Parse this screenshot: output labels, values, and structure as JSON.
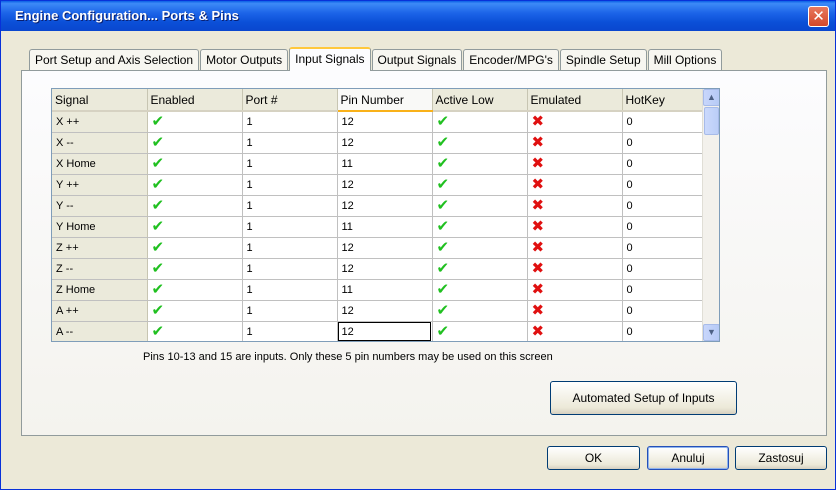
{
  "window": {
    "title": "Engine Configuration... Ports & Pins",
    "close_glyph": "✕"
  },
  "tabs": [
    {
      "label": "Port Setup and Axis Selection"
    },
    {
      "label": "Motor Outputs"
    },
    {
      "label": "Input Signals",
      "active": true
    },
    {
      "label": "Output Signals"
    },
    {
      "label": "Encoder/MPG's"
    },
    {
      "label": "Spindle Setup"
    },
    {
      "label": "Mill Options"
    }
  ],
  "grid": {
    "columns": [
      "Signal",
      "Enabled",
      "Port #",
      "Pin Number",
      "Active Low",
      "Emulated",
      "HotKey"
    ],
    "selected_column": "Pin Number",
    "rows": [
      {
        "signal": "X ++",
        "enabled": true,
        "port": "1",
        "pin": "12",
        "active_low": true,
        "emulated": false,
        "hotkey": "0"
      },
      {
        "signal": "X --",
        "enabled": true,
        "port": "1",
        "pin": "12",
        "active_low": true,
        "emulated": false,
        "hotkey": "0"
      },
      {
        "signal": "X Home",
        "enabled": true,
        "port": "1",
        "pin": "11",
        "active_low": true,
        "emulated": false,
        "hotkey": "0"
      },
      {
        "signal": "Y ++",
        "enabled": true,
        "port": "1",
        "pin": "12",
        "active_low": true,
        "emulated": false,
        "hotkey": "0"
      },
      {
        "signal": "Y --",
        "enabled": true,
        "port": "1",
        "pin": "12",
        "active_low": true,
        "emulated": false,
        "hotkey": "0"
      },
      {
        "signal": "Y Home",
        "enabled": true,
        "port": "1",
        "pin": "11",
        "active_low": true,
        "emulated": false,
        "hotkey": "0"
      },
      {
        "signal": "Z ++",
        "enabled": true,
        "port": "1",
        "pin": "12",
        "active_low": true,
        "emulated": false,
        "hotkey": "0"
      },
      {
        "signal": "Z --",
        "enabled": true,
        "port": "1",
        "pin": "12",
        "active_low": true,
        "emulated": false,
        "hotkey": "0"
      },
      {
        "signal": "Z Home",
        "enabled": true,
        "port": "1",
        "pin": "11",
        "active_low": true,
        "emulated": false,
        "hotkey": "0"
      },
      {
        "signal": "A ++",
        "enabled": true,
        "port": "1",
        "pin": "12",
        "active_low": true,
        "emulated": false,
        "hotkey": "0"
      },
      {
        "signal": "A --",
        "enabled": true,
        "port": "1",
        "pin": "12",
        "active_low": true,
        "emulated": false,
        "hotkey": "0"
      }
    ],
    "check_icon": "green-check-icon",
    "cross_icon": "red-cross-icon",
    "check_glyph": "✔",
    "cross_glyph": "✖"
  },
  "info_text": "Pins 10-13 and 15 are inputs. Only these 5 pin numbers may be used on this screen",
  "buttons": {
    "automated_setup": "Automated Setup of Inputs",
    "ok": "OK",
    "cancel": "Anuluj",
    "apply": "Zastosuj"
  },
  "scrollbar": {
    "up_glyph": "▲",
    "down_glyph": "▼"
  },
  "colors": {
    "titlebar": "#0a5fe6",
    "check": "#20c020",
    "cross": "#e01010",
    "tab_highlight": "#ffc83c"
  }
}
